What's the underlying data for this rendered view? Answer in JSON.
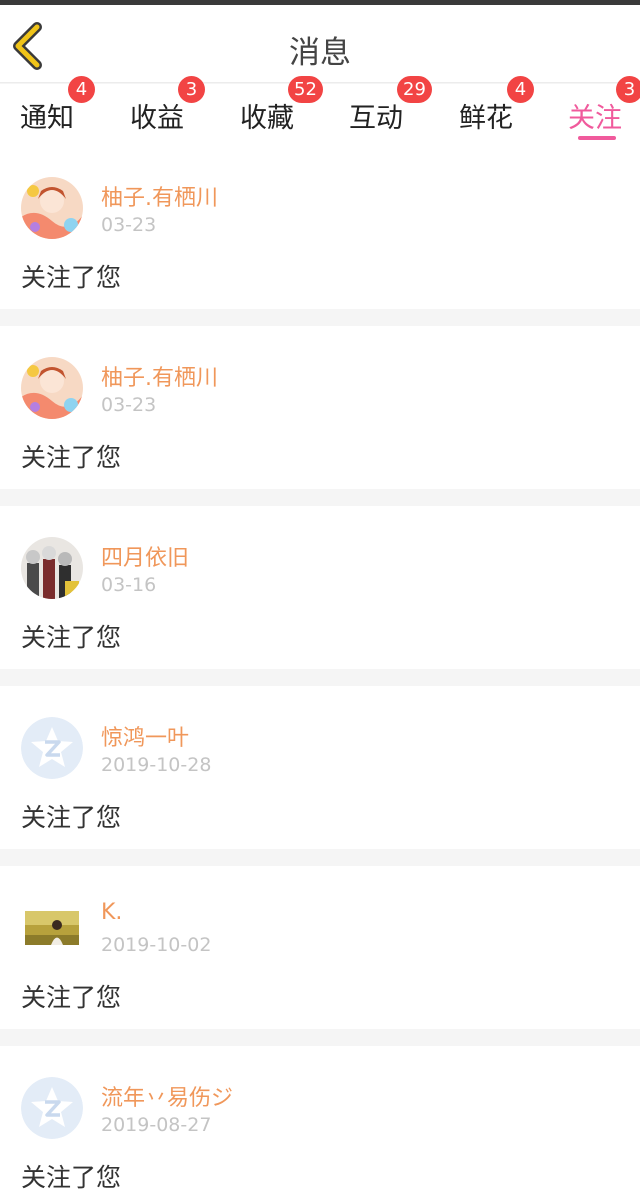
{
  "header": {
    "title": "消息",
    "back_icon": "chevron-left-icon",
    "accent_color": "#f0c419"
  },
  "tabs": [
    {
      "label": "通知",
      "badge": "4",
      "active": false
    },
    {
      "label": "收益",
      "badge": "3",
      "active": false
    },
    {
      "label": "收藏",
      "badge": "52",
      "active": false
    },
    {
      "label": "互动",
      "badge": "29",
      "active": false
    },
    {
      "label": "鲜花",
      "badge": "4",
      "active": false
    },
    {
      "label": "关注",
      "badge": "3",
      "active": true
    }
  ],
  "colors": {
    "active_tab": "#f05a9c",
    "badge": "#f24444",
    "username": "#f0975a",
    "date": "#c4c4c4"
  },
  "notifications": [
    {
      "username": "柚子.有栖川",
      "date": "03-23",
      "action": "关注了您",
      "avatar": "anime-avatar"
    },
    {
      "username": "柚子.有栖川",
      "date": "03-23",
      "action": "关注了您",
      "avatar": "anime-avatar"
    },
    {
      "username": "四月依旧",
      "date": "03-16",
      "action": "关注了您",
      "avatar": "group-anime-avatar"
    },
    {
      "username": "惊鸿一叶",
      "date": "2019-10-28",
      "action": "关注了您",
      "avatar": "default-avatar"
    },
    {
      "username": "K.",
      "date": "2019-10-02",
      "action": "关注了您",
      "avatar": "photo-avatar"
    },
    {
      "username": "流年丷易伤ジ",
      "date": "2019-08-27",
      "action": "关注了您",
      "avatar": "default-avatar"
    }
  ]
}
